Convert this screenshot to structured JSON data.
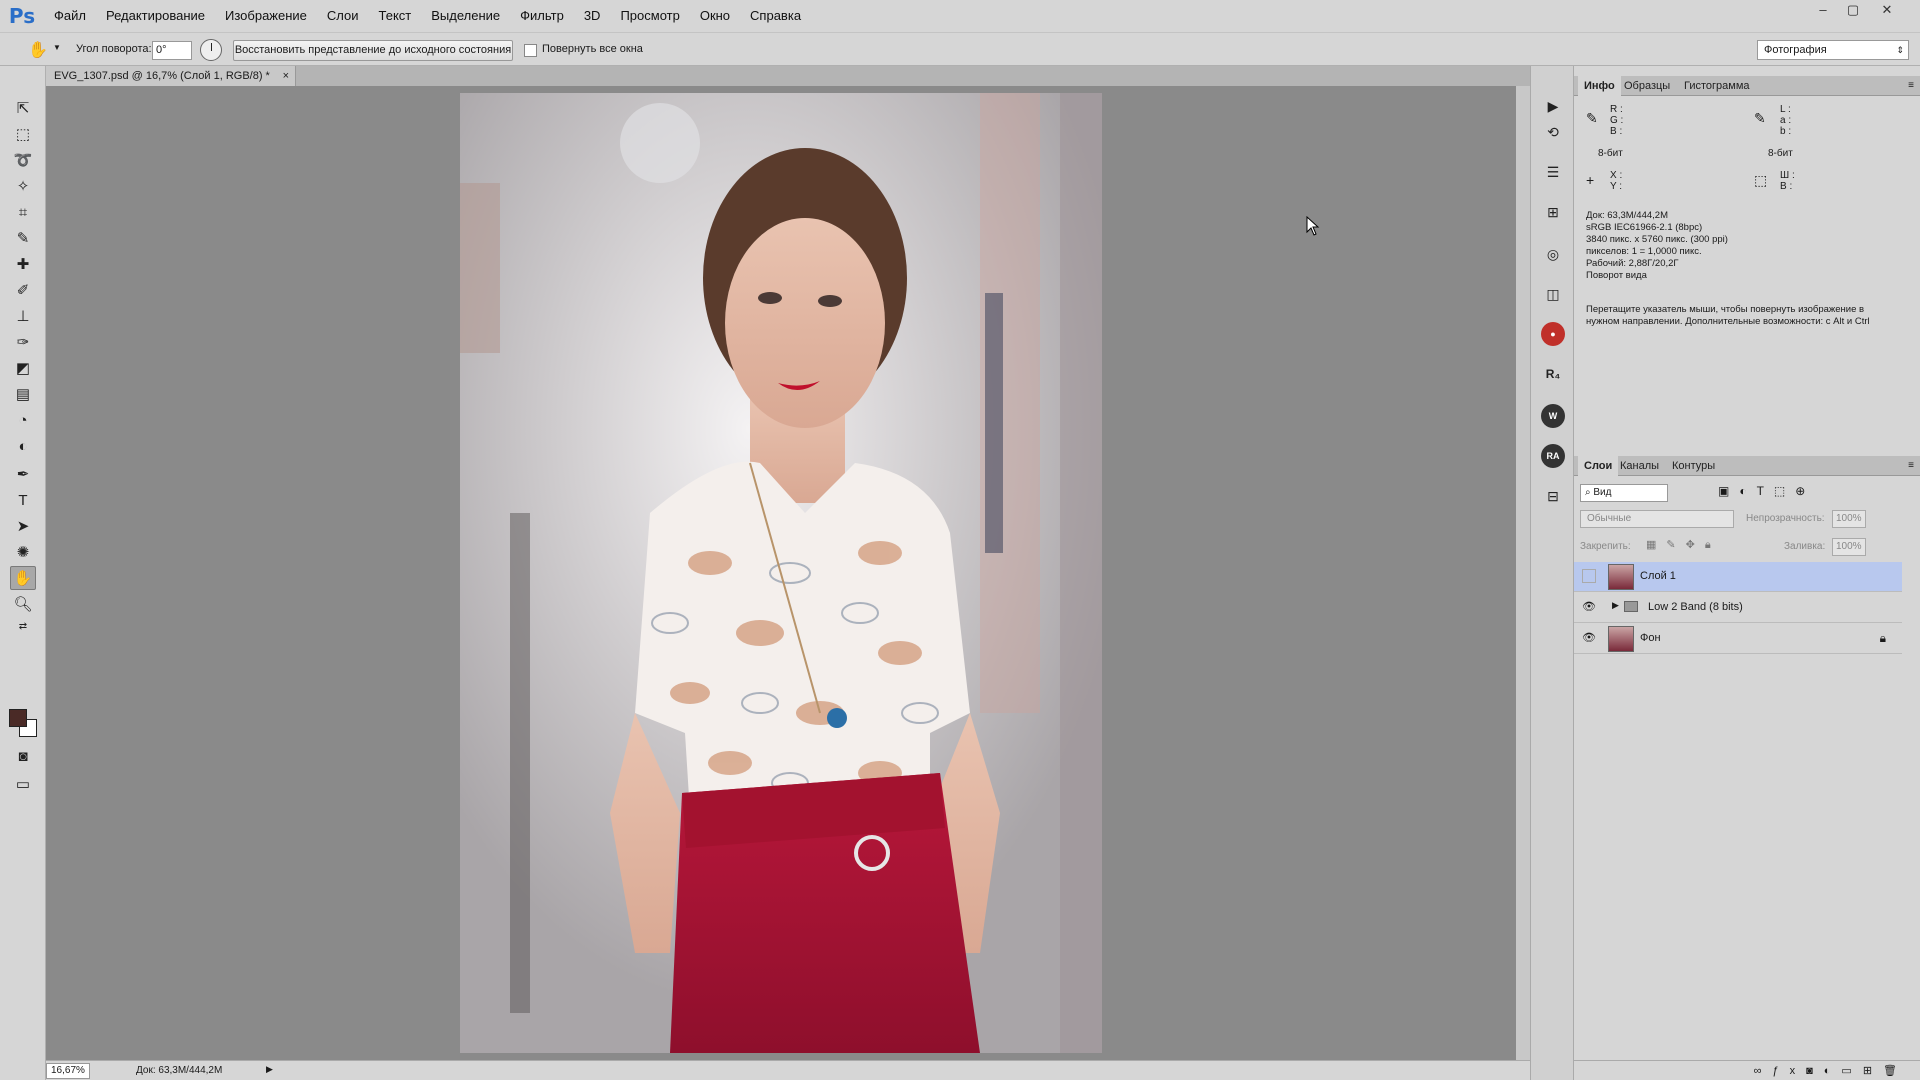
{
  "app": {
    "logo": "Ps",
    "menu": [
      "Файл",
      "Редактирование",
      "Изображение",
      "Слои",
      "Текст",
      "Выделение",
      "Фильтр",
      "3D",
      "Просмотр",
      "Окно",
      "Справка"
    ],
    "window_controls": [
      "–",
      "▢",
      "✕"
    ]
  },
  "options_bar": {
    "rotate_angle_label": "Угол поворота:",
    "rotate_angle_value": "0°",
    "reset_view_button": "Восстановить представление до исходного состояния",
    "rotate_all_label": "Повернуть все окна",
    "workspace": "Фотография"
  },
  "document": {
    "tab_title": "EVG_1307.psd @ 16,7% (Слой 1, RGB/8) *",
    "close": "×",
    "zoom": "16,67%",
    "status_size": "Док: 63,3M/444,2M",
    "status_arrow": "▶"
  },
  "info_panel": {
    "tabs": [
      "Инфо",
      "Образцы",
      "Гистограмма"
    ],
    "rgb_labels": [
      "R :",
      "G :",
      "B :"
    ],
    "lab_labels": [
      "L :",
      "a :",
      "b :"
    ],
    "bit_left": "8-бит",
    "bit_right": "8-бит",
    "xy_labels": [
      "X :",
      "Y :"
    ],
    "wh_labels": [
      "Ш :",
      "В :"
    ],
    "doc_info": [
      "Док: 63,3M/444,2M",
      "sRGB IEC61966-2.1 (8bpc)",
      "3840 пикс. x 5760 пикс. (300 ppi)",
      "пикселов: 1 = 1,0000 пикс.",
      "Рабочий: 2,88Г/20,2Г",
      "Поворот вида"
    ],
    "hint_line1": "Перетащите указатель мыши, чтобы повернуть изображение в",
    "hint_line2": "нужном направлении.  Дополнительные возможности: с Alt и Ctrl"
  },
  "layers_panel": {
    "tabs": [
      "Слои",
      "Каналы",
      "Контуры"
    ],
    "filter": "Вид",
    "blend_mode": "Обычные",
    "opacity_label": "Непрозрачность:",
    "opacity_value": "100%",
    "lock_label": "Закрепить:",
    "fill_label": "Заливка:",
    "fill_value": "100%",
    "layers": [
      {
        "name": "Слой 1",
        "visible": false,
        "selected": true
      },
      {
        "name": "Low 2 Band (8 bits)",
        "visible": true,
        "group": true
      },
      {
        "name": "Фон",
        "visible": true,
        "locked": true
      }
    ]
  }
}
